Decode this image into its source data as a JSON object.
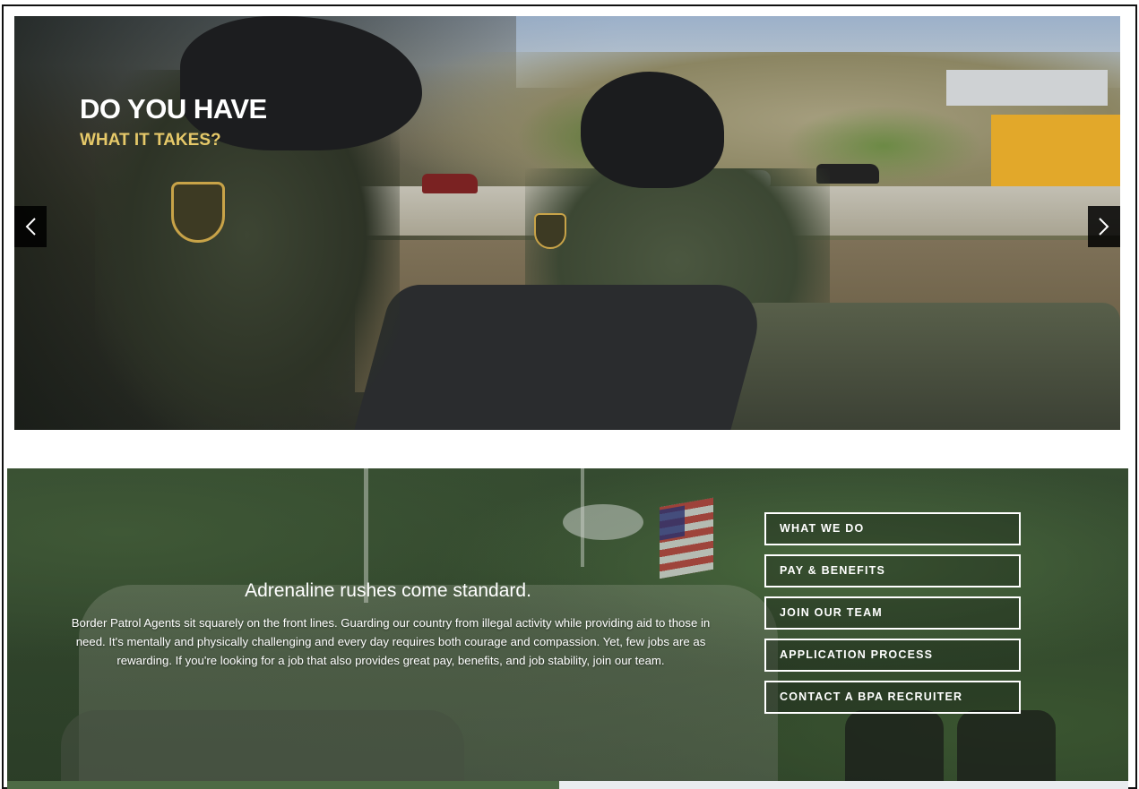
{
  "hero": {
    "title": "DO YOU HAVE",
    "subtitle": "WHAT IT TAKES?",
    "prev_icon": "chevron-left-icon",
    "next_icon": "chevron-right-icon"
  },
  "promo": {
    "heading": "Adrenaline rushes come standard.",
    "body": "Border Patrol Agents sit squarely on the front lines. Guarding our country from illegal activity while providing aid to those in need. It's mentally and physically challenging and every day requires both courage and compassion. Yet, few jobs are as rewarding. If you're looking for a job that also provides great pay, benefits, and job stability, join our team."
  },
  "menu": {
    "items": [
      {
        "label": "WHAT WE DO"
      },
      {
        "label": "PAY & BENEFITS"
      },
      {
        "label": "JOIN OUR TEAM"
      },
      {
        "label": "APPLICATION PROCESS"
      },
      {
        "label": "CONTACT A BPA RECRUITER"
      }
    ]
  },
  "colors": {
    "accent_yellow": "#e6c969",
    "promo_green": "#354b30"
  }
}
